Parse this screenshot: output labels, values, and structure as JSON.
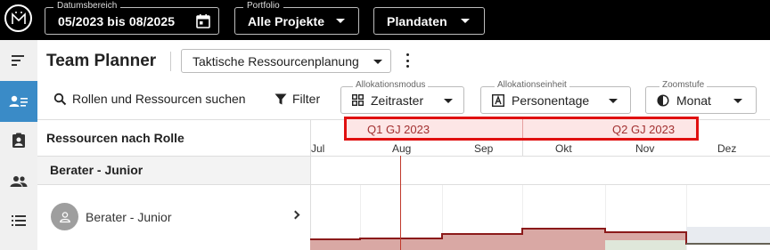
{
  "topbar": {
    "logo_icon": "app-logo-icon",
    "date_range": {
      "label": "Datumsbereich",
      "value": "05/2023 bis 08/2025",
      "icon": "calendar-icon"
    },
    "portfolio": {
      "label": "Portfolio",
      "value": "Alle Projekte"
    },
    "data_source": {
      "value": "Plandaten"
    }
  },
  "sidebar": {
    "accent_color": "#3a8bc7",
    "items": [
      {
        "name": "timeline",
        "icon": "gantt-icon",
        "active": false
      },
      {
        "name": "team-planner",
        "icon": "person-list-icon",
        "active": true
      },
      {
        "name": "assignments",
        "icon": "clipboard-person-icon",
        "active": false
      },
      {
        "name": "people",
        "icon": "group-icon",
        "active": false
      },
      {
        "name": "list",
        "icon": "list-icon",
        "active": false
      }
    ]
  },
  "header": {
    "title": "Team Planner",
    "view_select": "Taktische Ressourcenplanung",
    "more_icon": "more-vert-icon"
  },
  "toolbar": {
    "search_label": "Rollen und Ressourcen suchen",
    "filter_label": "Filter",
    "allocation_mode": {
      "label": "Allokationsmodus",
      "value": "Zeitraster",
      "icon": "grid-icon"
    },
    "allocation_unit": {
      "label": "Allokationseinheit",
      "value": "Personentage",
      "icon": "letter-a-box-icon"
    },
    "zoom": {
      "label": "Zoomstufe",
      "value": "Monat",
      "icon": "half-circle-icon"
    }
  },
  "grid": {
    "column_header": "Ressourcen nach Rolle",
    "quarters": [
      "Q1 GJ 2023",
      "Q2 GJ 2023"
    ],
    "months": [
      "Jul",
      "Aug",
      "Sep",
      "Okt",
      "Nov",
      "Dez"
    ],
    "group": "Berater - Junior",
    "resources": [
      {
        "name": "Berater - Junior",
        "avatar_icon": "person-avatar-icon",
        "expand_icon": "chevron-right-icon"
      }
    ],
    "highlight_color": "#e01010",
    "allocation_color": "#a52a2a"
  }
}
